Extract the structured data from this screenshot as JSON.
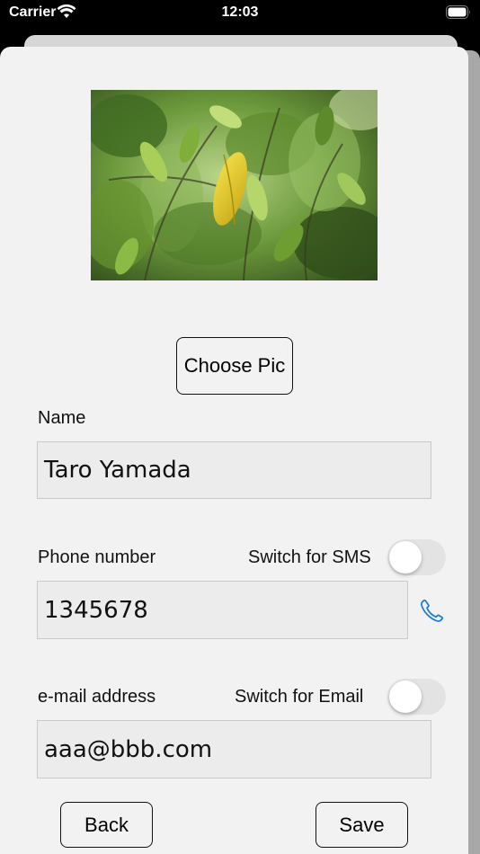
{
  "status_bar": {
    "carrier": "Carrier",
    "time": "12:03"
  },
  "colors": {
    "accent": "#1a7cd9",
    "sheet_background": "#f2f2f2",
    "field_background": "#ececec",
    "toggle_off": "#e3e3e3"
  },
  "form": {
    "choose_pic_label": "Choose Pic",
    "name": {
      "label": "Name",
      "value": "Taro Yamada"
    },
    "phone": {
      "label": "Phone number",
      "value": "1345678",
      "switch_label": "Switch for SMS",
      "switch_on": false
    },
    "email": {
      "label": "e-mail address",
      "value": "aaa@bbb.com",
      "switch_label": "Switch for Email",
      "switch_on": false
    },
    "back_label": "Back",
    "save_label": "Save"
  },
  "icons": {
    "phone": "phone-icon",
    "wifi": "wifi-icon",
    "battery": "battery-icon"
  }
}
